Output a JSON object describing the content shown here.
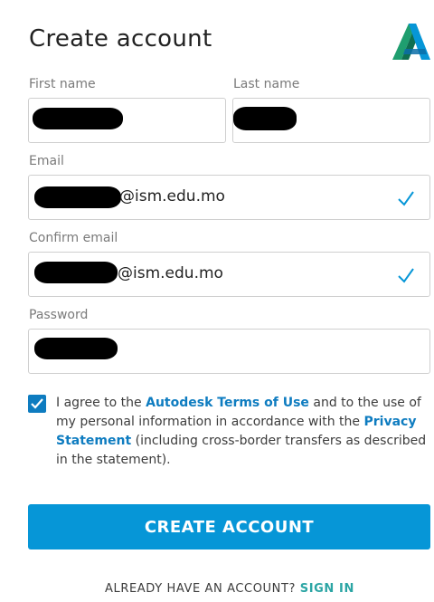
{
  "header": {
    "title": "Create account",
    "logo_icon": "autodesk-logo-icon"
  },
  "form": {
    "first_name": {
      "label": "First name",
      "value": ""
    },
    "last_name": {
      "label": "Last name",
      "value": ""
    },
    "email": {
      "label": "Email",
      "value_suffix": "@ism.edu.mo",
      "validated": true
    },
    "confirm_email": {
      "label": "Confirm email",
      "value_suffix": "@ism.edu.mo",
      "validated": true
    },
    "password": {
      "label": "Password",
      "value": ""
    }
  },
  "consent": {
    "checked": true,
    "text_1": "I agree to the ",
    "link_1": "Autodesk Terms of Use",
    "text_2": " and to the use of my personal information in accordance with the ",
    "link_2": "Privacy Statement",
    "text_3": " (including cross-border transfers as described in the statement)."
  },
  "submit": {
    "label": "CREATE ACCOUNT"
  },
  "footer": {
    "prompt": "ALREADY HAVE AN ACCOUNT? ",
    "sign_in": "SIGN IN"
  },
  "colors": {
    "accent": "#0696d7",
    "link": "#0e7cc0",
    "sign_in": "#2ba5a4",
    "check": "#0e7cc0"
  }
}
